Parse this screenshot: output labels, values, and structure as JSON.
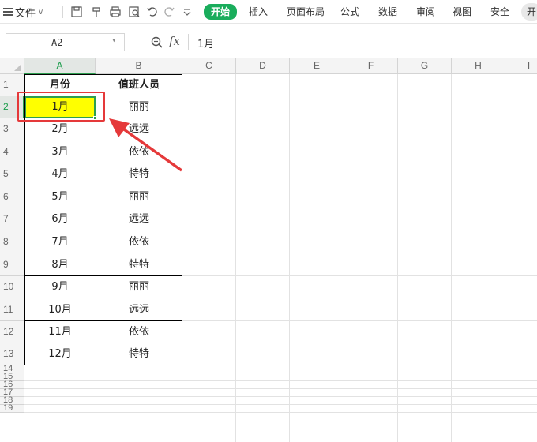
{
  "menu": {
    "file_label": "文件",
    "tabs": [
      "开始",
      "插入",
      "页面布局",
      "公式",
      "数据",
      "审阅",
      "视图",
      "安全",
      "开"
    ],
    "active_tab": "开始"
  },
  "formula_bar": {
    "name_box": "A2",
    "fx_label": "fx",
    "content": "1月"
  },
  "sheet": {
    "columns": [
      "A",
      "B",
      "C",
      "D",
      "E",
      "F",
      "G",
      "H",
      "I"
    ],
    "selected_column": "A",
    "rows": [
      "1",
      "2",
      "3",
      "4",
      "5",
      "6",
      "7",
      "8",
      "9",
      "10",
      "11",
      "12",
      "13",
      "14",
      "15",
      "16",
      "17",
      "18",
      "19"
    ],
    "selected_row": "2",
    "header": [
      "月份",
      "值班人员"
    ],
    "data": [
      [
        "1月",
        "丽丽"
      ],
      [
        "2月",
        "远远"
      ],
      [
        "3月",
        "依依"
      ],
      [
        "4月",
        "特特"
      ],
      [
        "5月",
        "丽丽"
      ],
      [
        "6月",
        "远远"
      ],
      [
        "7月",
        "依依"
      ],
      [
        "8月",
        "特特"
      ],
      [
        "9月",
        "丽丽"
      ],
      [
        "10月",
        "远远"
      ],
      [
        "11月",
        "依依"
      ],
      [
        "12月",
        "特特"
      ]
    ],
    "selected_cell": "A2"
  },
  "colors": {
    "accent_green": "#1aad5c",
    "selection_fill": "#ffff00",
    "annotation_red": "#e5393a"
  }
}
